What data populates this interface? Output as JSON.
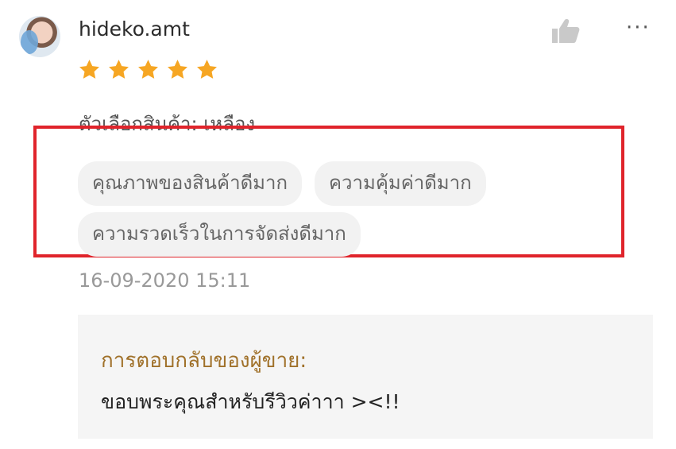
{
  "review": {
    "username": "hideko.amt",
    "rating": 5,
    "rating_max": 5,
    "variant_label": "ตัวเลือกสินค้า: เหลือง",
    "tags": [
      "คุณภาพของสินค้าดีมาก",
      "ความคุ้มค่าดีมาก",
      "ความรวดเร็วในการจัดส่งดีมาก"
    ],
    "timestamp": "16-09-2020 15:11",
    "more_icon": "···"
  },
  "seller_reply": {
    "title": "การตอบกลับของผู้ขาย:",
    "body": "ขอบพระคุณสำหรับรีวิวค่าาา ><!!"
  },
  "colors": {
    "star": "#f6a623",
    "highlight_border": "#e0242b",
    "reply_title": "#a0712a",
    "tag_bg": "#f2f2f2"
  },
  "icons": [
    "avatar",
    "thumbs-up-icon",
    "more-options-icon",
    "star-icon"
  ]
}
